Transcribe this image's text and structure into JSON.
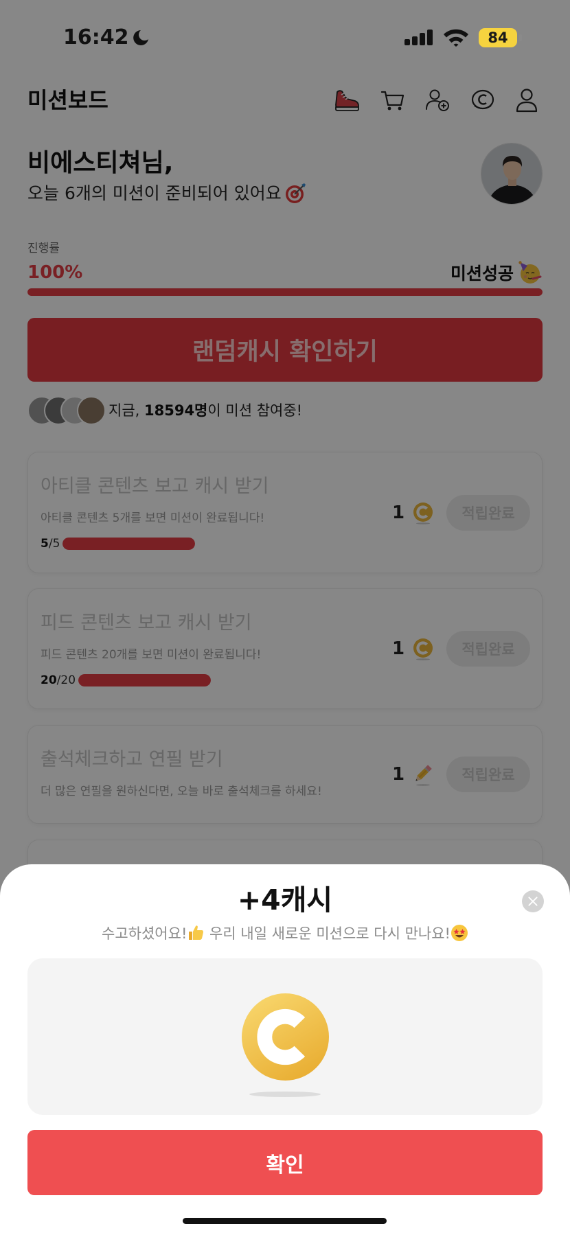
{
  "status_bar": {
    "time": "16:42",
    "battery": "84",
    "icons": [
      "moon-icon",
      "cellular-signal-icon",
      "wifi-icon",
      "battery-indicator"
    ]
  },
  "header": {
    "title": "미션보드",
    "icons": [
      "sneaker-icon",
      "cart-icon",
      "add-friend-icon",
      "cash-coin-icon",
      "profile-icon"
    ]
  },
  "greeting": {
    "name": "비에스티쳐님,",
    "message": "오늘 6개의 미션이 준비되어 있어요",
    "emoji_icon": "target-emoji-icon"
  },
  "progress": {
    "label": "진행률",
    "percent_text": "100%",
    "status": "미션성공",
    "status_emoji_icon": "party-face-emoji-icon",
    "value": 1.0
  },
  "random_cash_button": {
    "label": "랜덤캐시 확인하기"
  },
  "participants": {
    "prefix": "지금, ",
    "count": "18594명",
    "suffix": "이 미션 참여중!"
  },
  "missions": [
    {
      "title": "아티클 콘텐츠 보고 캐시 받기",
      "description": "아티클 콘텐츠 5개를 보면 미션이 완료됩니다!",
      "progress_done": "5",
      "progress_rest": "/5",
      "progress_value": 1.0,
      "reward": "1",
      "reward_icon": "coin-icon",
      "button": "적립완료"
    },
    {
      "title": "피드 콘텐츠 보고 캐시 받기",
      "description": "피드 콘텐츠 20개를 보면 미션이 완료됩니다!",
      "progress_done": "20",
      "progress_rest": "/20",
      "progress_value": 1.0,
      "reward": "1",
      "reward_icon": "coin-icon",
      "button": "적립완료"
    },
    {
      "title": "출석체크하고 연필 받기",
      "description": "더 많은 연필을 원하신다면, 오늘 바로 출석체크를 하세요!",
      "reward": "1",
      "reward_icon": "pencil-icon",
      "button": "적립완료"
    }
  ],
  "reward_sheet": {
    "title": "+4캐시",
    "message_part1": "수고하셨어요!",
    "message_part2": " 우리 내일 새로운 미션으로 다시 만나요!",
    "emoji_icons": [
      "thumbs-up-emoji-icon",
      "star-struck-emoji-icon"
    ],
    "coin_icon": "cash-coin-icon",
    "confirm": "확인"
  },
  "colors": {
    "accent": "#e53e45",
    "confirm": "#ef4f51",
    "coin": "#ecb73d",
    "battery": "#f6d33f"
  }
}
